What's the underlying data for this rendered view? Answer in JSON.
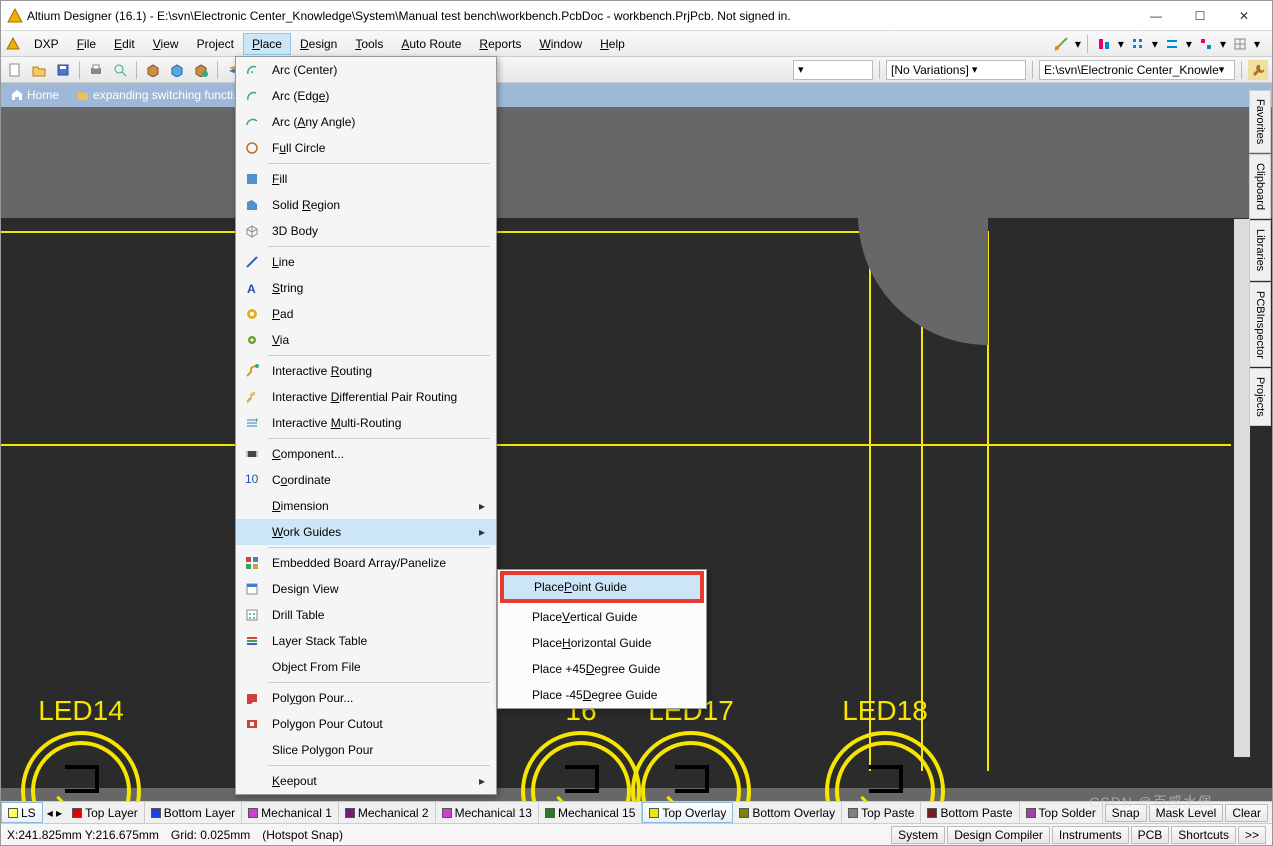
{
  "title": "Altium Designer (16.1) - E:\\svn\\Electronic Center_Knowledge\\System\\Manual test bench\\workbench.PcbDoc - workbench.PrjPcb. Not signed in.",
  "menubar": {
    "dxp": "DXP",
    "items": [
      "File",
      "Edit",
      "View",
      "Project",
      "Place",
      "Design",
      "Tools",
      "Auto Route",
      "Reports",
      "Window",
      "Help"
    ]
  },
  "toolbar2": {
    "variations": "[No Variations]",
    "path": "E:\\svn\\Electronic Center_Knowle"
  },
  "breadcrumb": {
    "home": "Home",
    "item": "expanding switching functi..."
  },
  "place_menu": [
    {
      "label": "Arc (Center)",
      "icon": "arc-center"
    },
    {
      "label": "Arc (Edge)",
      "icon": "arc-edge",
      "u": 8
    },
    {
      "label": "Arc (Any Angle)",
      "icon": "arc-any",
      "u": 5
    },
    {
      "label": "Full Circle",
      "icon": "circle",
      "u": 1
    },
    {
      "sep": true
    },
    {
      "label": "Fill",
      "icon": "fill",
      "u": 0
    },
    {
      "label": "Solid Region",
      "icon": "region",
      "u": 6
    },
    {
      "label": "3D Body",
      "icon": "3d"
    },
    {
      "sep": true
    },
    {
      "label": "Line",
      "icon": "line",
      "u": 0
    },
    {
      "label": "String",
      "icon": "string",
      "u": 0
    },
    {
      "label": "Pad",
      "icon": "pad",
      "u": 0
    },
    {
      "label": "Via",
      "icon": "via",
      "u": 0
    },
    {
      "sep": true
    },
    {
      "label": "Interactive Routing",
      "icon": "route",
      "u": 12
    },
    {
      "label": "Interactive Differential Pair Routing",
      "icon": "diff",
      "u": 12
    },
    {
      "label": "Interactive Multi-Routing",
      "icon": "multi",
      "u": 12
    },
    {
      "sep": true
    },
    {
      "label": "Component...",
      "icon": "comp",
      "u": 0
    },
    {
      "label": "Coordinate",
      "icon": "coord",
      "u": 1
    },
    {
      "label": "Dimension",
      "icon": "",
      "u": 0,
      "sub": true
    },
    {
      "label": "Work Guides",
      "icon": "",
      "u": 0,
      "sub": true,
      "hi": true
    },
    {
      "sep": true
    },
    {
      "label": "Embedded Board Array/Panelize",
      "icon": "embed"
    },
    {
      "label": "Design View",
      "icon": "dview"
    },
    {
      "label": "Drill Table",
      "icon": "drill"
    },
    {
      "label": "Layer Stack Table",
      "icon": "stack"
    },
    {
      "label": "Object From File",
      "icon": ""
    },
    {
      "sep": true
    },
    {
      "label": "Polygon Pour...",
      "icon": "poly",
      "u": 3
    },
    {
      "label": "Polygon Pour Cutout",
      "icon": "polyc"
    },
    {
      "label": "Slice Polygon Pour",
      "icon": ""
    },
    {
      "sep": true
    },
    {
      "label": "Keepout",
      "icon": "",
      "u": 0,
      "sub": true
    }
  ],
  "submenu": [
    {
      "label": "Place Point Guide",
      "hi": true,
      "u": 6
    },
    {
      "label": "Place Vertical Guide",
      "u": 6
    },
    {
      "label": "Place Horizontal Guide",
      "u": 6
    },
    {
      "label": "Place +45 Degree Guide",
      "u": 10
    },
    {
      "label": "Place -45 Degree Guide",
      "u": 10
    }
  ],
  "leds": [
    "LED14",
    "16",
    "LED17",
    "LED18"
  ],
  "layers": [
    {
      "name": "LS",
      "color": "#ffff66",
      "active": true
    },
    {
      "name": "Top Layer",
      "color": "#e40000"
    },
    {
      "name": "Bottom Layer",
      "color": "#2040e0"
    },
    {
      "name": "Mechanical 1",
      "color": "#d040d0"
    },
    {
      "name": "Mechanical 2",
      "color": "#702070"
    },
    {
      "name": "Mechanical 13",
      "color": "#d040d0"
    },
    {
      "name": "Mechanical 15",
      "color": "#208020"
    },
    {
      "name": "Top Overlay",
      "color": "#e8e800",
      "active2": true
    },
    {
      "name": "Bottom Overlay",
      "color": "#808000"
    },
    {
      "name": "Top Paste",
      "color": "#808080"
    },
    {
      "name": "Bottom Paste",
      "color": "#702020"
    },
    {
      "name": "Top Solder",
      "color": "#a040a0"
    }
  ],
  "layer_right": [
    "Snap",
    "Mask Level",
    "Clear"
  ],
  "status": {
    "coord": "X:241.825mm Y:216.675mm",
    "grid": "Grid: 0.025mm",
    "snap": "(Hotspot Snap)"
  },
  "status_right": [
    "System",
    "Design Compiler",
    "Instruments",
    "PCB",
    "Shortcuts",
    ">>"
  ],
  "right_tabs": [
    "Favorites",
    "Clipboard",
    "Libraries",
    "PCBInspector",
    "Projects"
  ],
  "watermark": "CSDN @百感水佩"
}
